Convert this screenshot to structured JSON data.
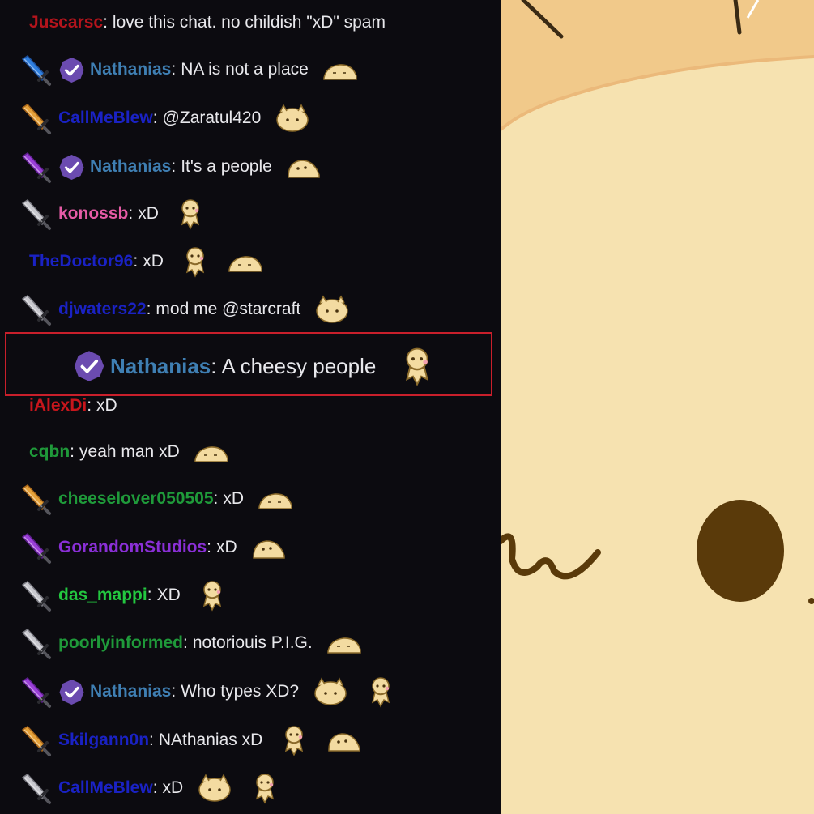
{
  "chat": {
    "messages": [
      {
        "user": "Juscarsc",
        "color": "#b5141c",
        "badge": null,
        "verified": false,
        "text": "love this chat. no childish \"xD\" spam",
        "emotes": []
      },
      {
        "user": "Nathanias",
        "color": "#3f7fb3",
        "badge": "blue-sword-icon",
        "verified": true,
        "text": "NA is not a place",
        "emotes": [
          "cheese-cat-lying-emote"
        ]
      },
      {
        "user": "CallMeBlew",
        "color": "#1a22c4",
        "badge": "gold-sword-icon",
        "verified": false,
        "text": "@Zaratul420",
        "emotes": [
          "cheese-cat-face-emote"
        ]
      },
      {
        "user": "Nathanias",
        "color": "#3f7fb3",
        "badge": "purple-sword-icon",
        "verified": true,
        "text": "It's a people",
        "emotes": [
          "cheese-cat-flop-emote"
        ]
      },
      {
        "user": "konossb",
        "color": "#e65ba6",
        "badge": "silver-sword-icon",
        "verified": false,
        "text": "xD",
        "emotes": [
          "cheese-cat-dance-emote"
        ]
      },
      {
        "user": "TheDoctor96",
        "color": "#1a22c4",
        "badge": null,
        "verified": false,
        "text": "xD",
        "emotes": [
          "cheese-cat-dance-emote",
          "cheese-cat-lying-emote"
        ]
      },
      {
        "user": "djwaters22",
        "color": "#1a22c4",
        "badge": "silver-sword-icon",
        "verified": false,
        "text": "mod me @starcraft",
        "emotes": [
          "cheese-cat-face-emote"
        ]
      },
      {
        "user": "Nathanias",
        "color": "#3f7fb3",
        "badge": null,
        "verified": true,
        "text": "A cheesy people",
        "emotes": [
          "cheese-cat-dance-emote"
        ],
        "highlighted": true
      },
      {
        "user": "iAlexDi",
        "color": "#c8161c",
        "badge": null,
        "verified": false,
        "text": "xD",
        "emotes": []
      },
      {
        "user": "cqbn",
        "color": "#1f9a3a",
        "badge": null,
        "verified": false,
        "text": "yeah man xD",
        "emotes": [
          "cheese-cat-lying-emote"
        ]
      },
      {
        "user": "cheeselover050505",
        "color": "#1f9a3a",
        "badge": "gold-sword-icon",
        "verified": false,
        "text": "xD",
        "emotes": [
          "cheese-cat-lying-emote"
        ]
      },
      {
        "user": "GorandomStudios",
        "color": "#8a2fd6",
        "badge": "purple-sword-icon",
        "verified": false,
        "text": "xD",
        "emotes": [
          "cheese-cat-flop-emote"
        ]
      },
      {
        "user": "das_mappi",
        "color": "#23c840",
        "badge": "silver-sword-icon",
        "verified": false,
        "text": "XD",
        "emotes": [
          "cheese-cat-dance-emote"
        ]
      },
      {
        "user": "poorlyinformed",
        "color": "#1f9a3a",
        "badge": "silver-sword-icon",
        "verified": false,
        "text": "notoriouis P.I.G.",
        "emotes": [
          "cheese-cat-lying-emote"
        ]
      },
      {
        "user": "Nathanias",
        "color": "#3f7fb3",
        "badge": "purple-sword-icon",
        "verified": true,
        "text": "Who types XD?",
        "emotes": [
          "cheese-cat-face-emote",
          "cheese-cat-dance-emote"
        ]
      },
      {
        "user": "Skilgann0n",
        "color": "#1a22c4",
        "badge": "gold-sword-icon",
        "verified": false,
        "text": "NAthanias xD",
        "emotes": [
          "cheese-cat-dance-emote",
          "cheese-cat-flop-emote"
        ]
      },
      {
        "user": "CallMeBlew",
        "color": "#1a22c4",
        "badge": "silver-sword-icon",
        "verified": false,
        "text": "xD",
        "emotes": [
          "cheese-cat-face-emote",
          "cheese-cat-dance-emote"
        ]
      }
    ]
  },
  "colors": {
    "chat_bg": "#0c0b10",
    "text": "#e8e8ec",
    "highlight_border": "#c91f2b",
    "verified_badge": "#6b4bb0",
    "art_bg": "#f6e2b0",
    "art_top": "#f1c98a",
    "art_eye": "#5a3a0a"
  }
}
